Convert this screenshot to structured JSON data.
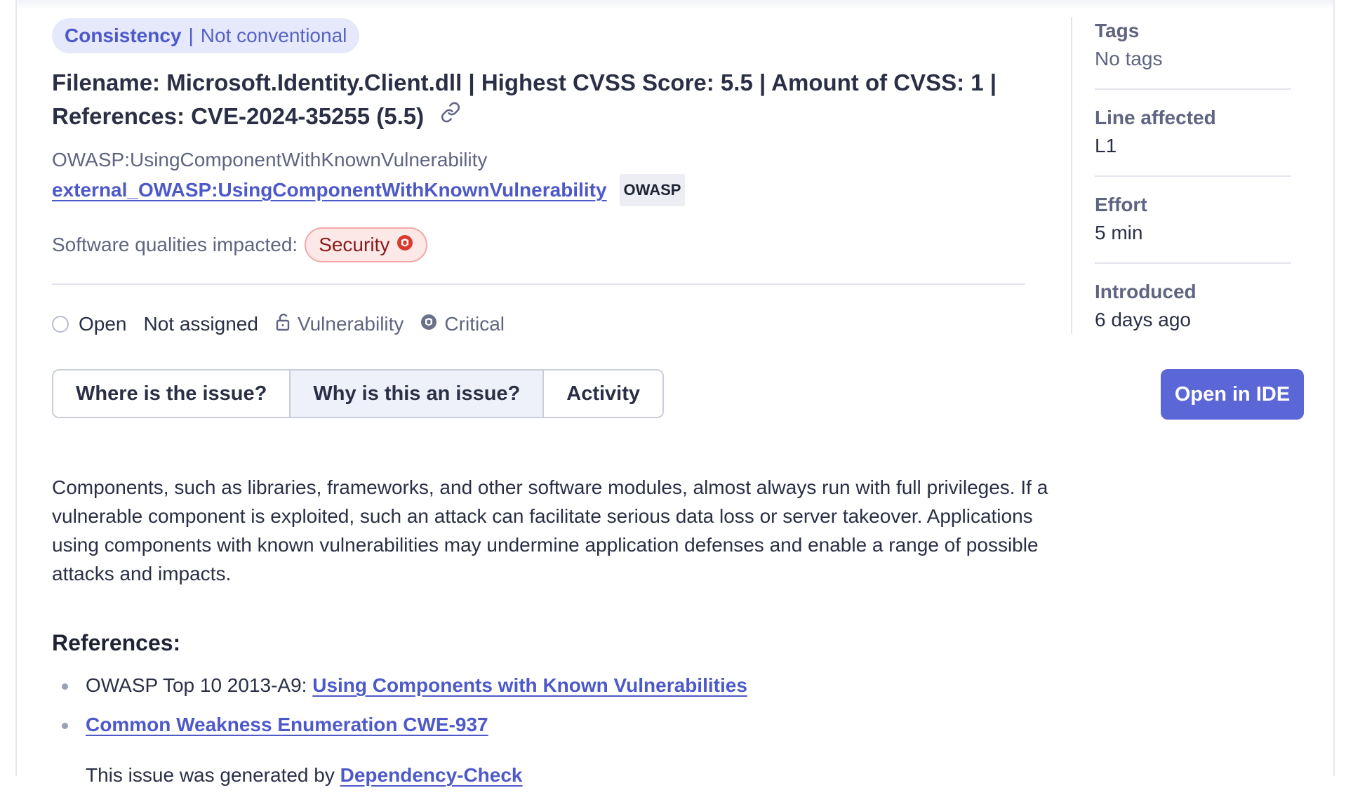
{
  "header": {
    "pill_primary": "Consistency",
    "pill_secondary": "Not conventional"
  },
  "issue": {
    "title_line1": "Filename: Microsoft.Identity.Client.dll | Highest CVSS Score: 5.5 | Amount of CVSS: 1 |",
    "title_line2": "References: CVE-2024-35255 (5.5)",
    "rule_key": "OWASP:UsingComponentWithKnownVulnerability",
    "rule_link": "external_OWASP:UsingComponentWithKnownVulnerability",
    "rule_tag": "OWASP",
    "qualities_label": "Software qualities impacted:",
    "quality_badge": "Security"
  },
  "status": {
    "state": "Open",
    "assignee": "Not assigned",
    "type": "Vulnerability",
    "severity": "Critical"
  },
  "tabs": [
    {
      "label": "Where is the issue?"
    },
    {
      "label": "Why is this an issue?"
    },
    {
      "label": "Activity"
    }
  ],
  "actions": {
    "open_ide": "Open in IDE"
  },
  "description": "Components, such as libraries, frameworks, and other software modules, almost always run with full privileges. If a vulnerable component is exploited, such an attack can facilitate serious data loss or server takeover. Applications using components with known vulnerabilities may undermine application defenses and enable a range of possible attacks and impacts.",
  "references": {
    "title": "References:",
    "item1_prefix": "OWASP Top 10 2013-A9:",
    "item1_link": "Using Components with Known Vulnerabilities",
    "item2_link": "Common Weakness Enumeration CWE-937",
    "generated_prefix": "This issue was generated by",
    "generated_link": "Dependency-Check"
  },
  "sidebar": {
    "tags_label": "Tags",
    "tags_value": "No tags",
    "line_label": "Line affected",
    "line_value": "L1",
    "effort_label": "Effort",
    "effort_value": "5 min",
    "introduced_label": "Introduced",
    "introduced_value": "6 days ago"
  },
  "colors": {
    "accent": "#5b67d6",
    "link": "#4d59c9",
    "security_bg": "#fde8e8",
    "security_border": "#f4a6a6",
    "security_icon": "#d93a2b"
  }
}
